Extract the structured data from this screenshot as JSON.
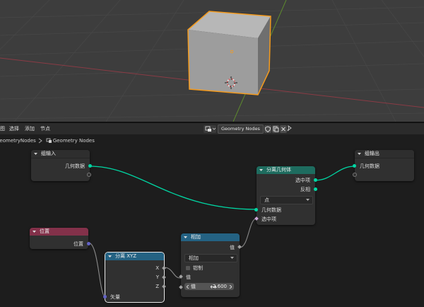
{
  "header": {
    "menus": [
      "图",
      "选择",
      "添加",
      "节点"
    ],
    "node_tree_name": "Geometry Nodes"
  },
  "breadcrumb": {
    "object": "GeometryNodes",
    "tree": "Geometry Nodes"
  },
  "nodes": {
    "group_input": {
      "title": "组输入",
      "out_geometry": "几何数据"
    },
    "group_output": {
      "title": "组输出",
      "in_geometry": "几何数据"
    },
    "position": {
      "title": "位置",
      "out_position": "位置"
    },
    "separate_geometry": {
      "title": "分离几何体",
      "out_selection": "选中项",
      "out_inverted": "反相",
      "domain": "点",
      "in_geometry": "几何数据",
      "in_selection": "选中项"
    },
    "separate_xyz": {
      "title": "分离 XYZ",
      "out_x": "X",
      "out_y": "Y",
      "out_z": "Z",
      "in_vector": "矢量"
    },
    "compare": {
      "title": "相加",
      "out_value": "值",
      "operation": "相加",
      "clamp": "钳制",
      "in_value": "值",
      "field_label": "值",
      "field_value": "2.600"
    }
  },
  "colors": {
    "geometry_socket": "#00d6a3",
    "selection_link": "#cca6d6",
    "vector_socket": "#6363c7",
    "float_socket": "#a1a1a1",
    "object_outline": "#f59b1d",
    "input_header": "#83314a",
    "geometry_header": "#1e6c5f",
    "converter_header": "#246283"
  }
}
